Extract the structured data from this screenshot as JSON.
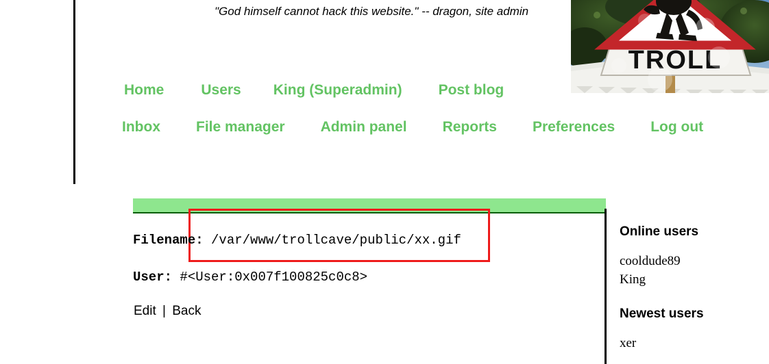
{
  "header": {
    "quote": "\"God himself cannot hack this website.\" -- dragon, site admin",
    "banner_icon": "troll-road-sign-photo",
    "banner_sign_text": "TROLL"
  },
  "nav": {
    "row1": [
      {
        "label": "Home",
        "name": "nav-link-home"
      },
      {
        "label": "Users",
        "name": "nav-link-users"
      },
      {
        "label": "King (Superadmin)",
        "name": "nav-link-king-superadmin"
      },
      {
        "label": "Post blog",
        "name": "nav-link-post-blog"
      }
    ],
    "row2": [
      {
        "label": "Inbox",
        "name": "nav-link-inbox"
      },
      {
        "label": "File manager",
        "name": "nav-link-file-manager"
      },
      {
        "label": "Admin panel",
        "name": "nav-link-admin-panel"
      },
      {
        "label": "Reports",
        "name": "nav-link-reports"
      },
      {
        "label": "Preferences",
        "name": "nav-link-preferences"
      },
      {
        "label": "Log out",
        "name": "nav-link-log-out"
      }
    ]
  },
  "main": {
    "filename_label": "Filename:",
    "filename_value": "/var/www/trollcave/public/xx.gif",
    "user_label": "User:",
    "user_value": "#<User:0x007f100825c0c8>",
    "edit_link": "Edit",
    "separator": "|",
    "back_link": "Back"
  },
  "sidebar": {
    "online_heading": "Online users",
    "online_users": [
      "cooldude89",
      "King"
    ],
    "newest_heading": "Newest users",
    "newest_users": [
      "xer"
    ]
  },
  "colors": {
    "nav_link_green": "#63c363",
    "panel_bar_green": "#8ee68e",
    "panel_bar_border": "#0b5d0b",
    "highlight_red": "#ee1b1b",
    "rule_black": "#000000"
  }
}
